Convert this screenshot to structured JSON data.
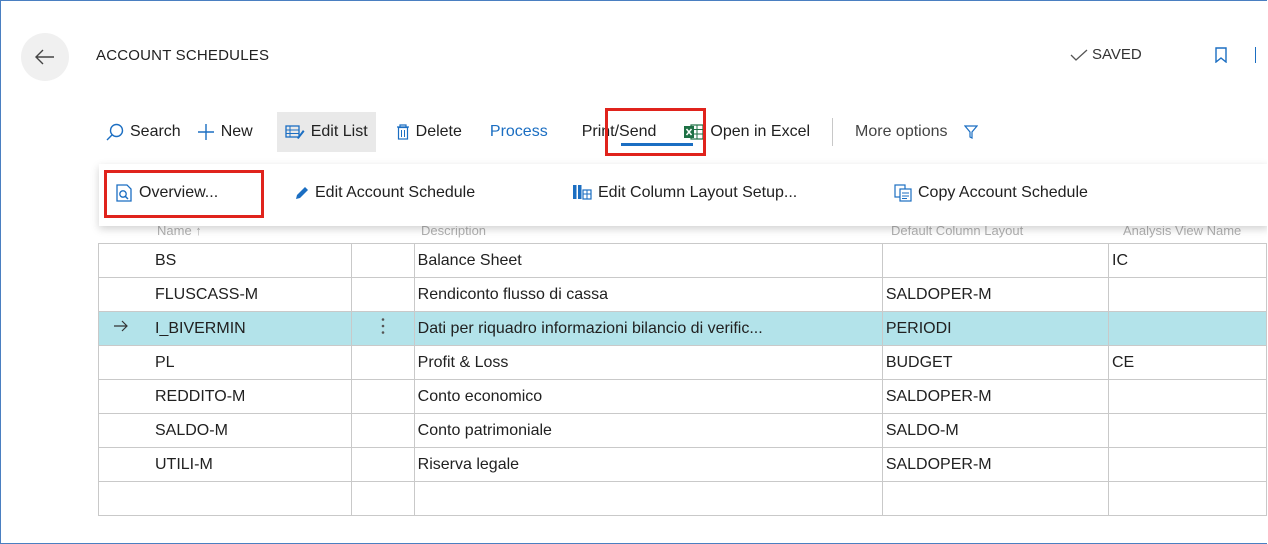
{
  "header": {
    "title": "ACCOUNT SCHEDULES",
    "saved_label": "SAVED"
  },
  "actions": {
    "search": "Search",
    "new": "New",
    "edit_list": "Edit List",
    "delete": "Delete",
    "process": "Process",
    "print_send": "Print/Send",
    "open_in_excel": "Open in Excel",
    "more_options": "More options"
  },
  "process_menu": {
    "overview": "Overview...",
    "edit_account_schedule": "Edit Account Schedule",
    "edit_column_layout_setup": "Edit Column Layout Setup...",
    "copy_account_schedule": "Copy Account Schedule"
  },
  "table": {
    "columns": [
      "Name ↑",
      "Description",
      "Default Column Layout",
      "Analysis View Name"
    ],
    "rows": [
      {
        "name": "BS",
        "description": "Balance Sheet",
        "layout": "",
        "analysis": "IC"
      },
      {
        "name": "FLUSCASS-M",
        "description": "Rendiconto flusso di cassa",
        "layout": "SALDOPER-M",
        "analysis": ""
      },
      {
        "name": "I_BIVERMIN",
        "description": "Dati per riquadro informazioni bilancio di verific...",
        "layout": "PERIODI",
        "analysis": ""
      },
      {
        "name": "PL",
        "description": "Profit & Loss",
        "layout": "BUDGET",
        "analysis": "CE"
      },
      {
        "name": "REDDITO-M",
        "description": "Conto economico",
        "layout": "SALDOPER-M",
        "analysis": ""
      },
      {
        "name": "SALDO-M",
        "description": "Conto patrimoniale",
        "layout": "SALDO-M",
        "analysis": ""
      },
      {
        "name": "UTILI-M",
        "description": "Riserva legale",
        "layout": "SALDOPER-M",
        "analysis": ""
      },
      {
        "name": "",
        "description": "",
        "layout": "",
        "analysis": ""
      }
    ]
  },
  "colors": {
    "accent": "#1b6ec2",
    "highlight_red": "#e0231c",
    "selected_row": "#b3e3ea",
    "excel_green": "#1e7145"
  }
}
